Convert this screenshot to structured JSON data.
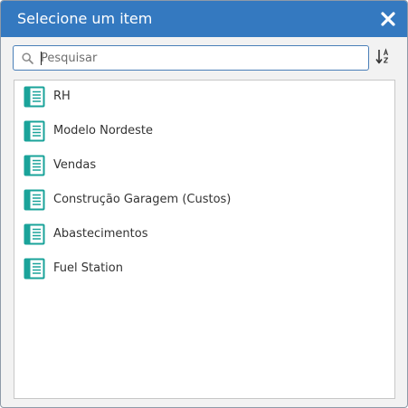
{
  "dialog": {
    "title": "Selecione um item",
    "close_icon": "close-icon"
  },
  "search": {
    "placeholder": "Pesquisar",
    "value": "",
    "icon": "search-icon"
  },
  "sort": {
    "icon": "sort-alpha-icon"
  },
  "list": {
    "item_icon": "report-book-icon",
    "icon_color": "#1aa39a",
    "items": [
      {
        "label": "RH"
      },
      {
        "label": "Modelo Nordeste"
      },
      {
        "label": "Vendas"
      },
      {
        "label": "Construção Garagem (Custos)"
      },
      {
        "label": "Abastecimentos"
      },
      {
        "label": "Fuel Station"
      }
    ]
  },
  "colors": {
    "titlebar": "#3479c0",
    "dialog_background": "#f2f2f2",
    "search_border": "#4a7fb8"
  }
}
